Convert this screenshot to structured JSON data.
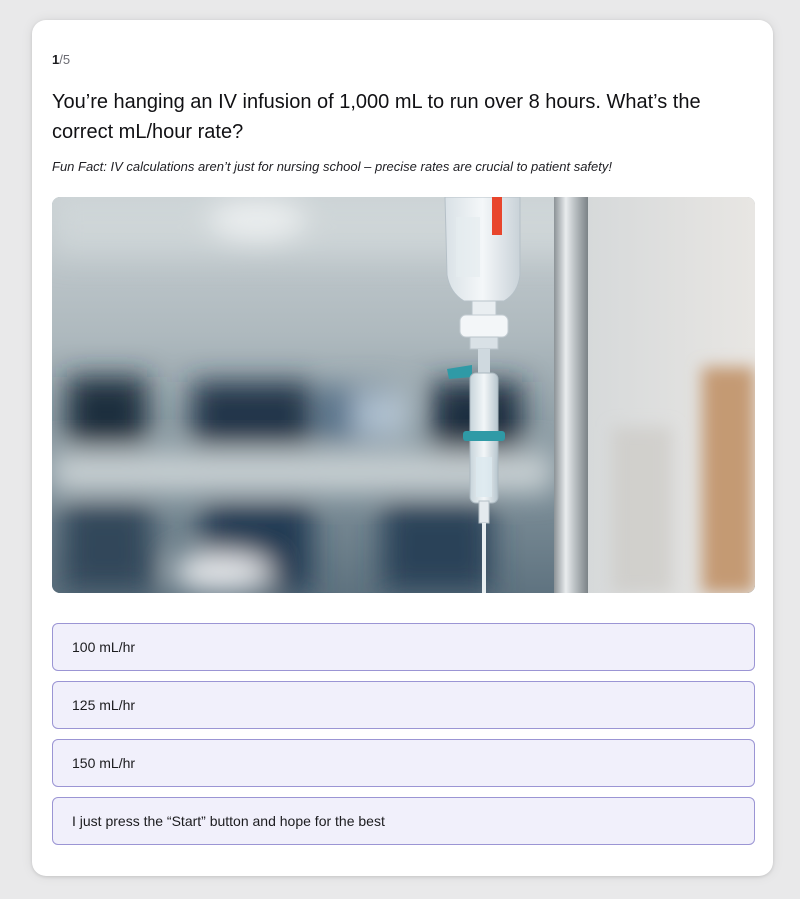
{
  "quiz": {
    "progress_current": "1",
    "progress_total": "/5",
    "question": "You’re hanging an IV infusion of 1,000 mL to run over 8 hours. What’s the correct mL/hour rate?",
    "fun_fact": "Fun Fact: IV calculations aren’t just for nursing school – precise rates are crucial to patient safety!",
    "options": [
      {
        "label": "100 mL/hr"
      },
      {
        "label": "125 mL/hr"
      },
      {
        "label": "150 mL/hr"
      },
      {
        "label": "I just press the “Start” button and hope for the best"
      }
    ]
  },
  "colors": {
    "option_background": "#f1f0fb",
    "option_border": "#9b95d4",
    "drip_chamber_clamp": "#2f9aa6",
    "bag_label_stripe": "#e8452c"
  }
}
